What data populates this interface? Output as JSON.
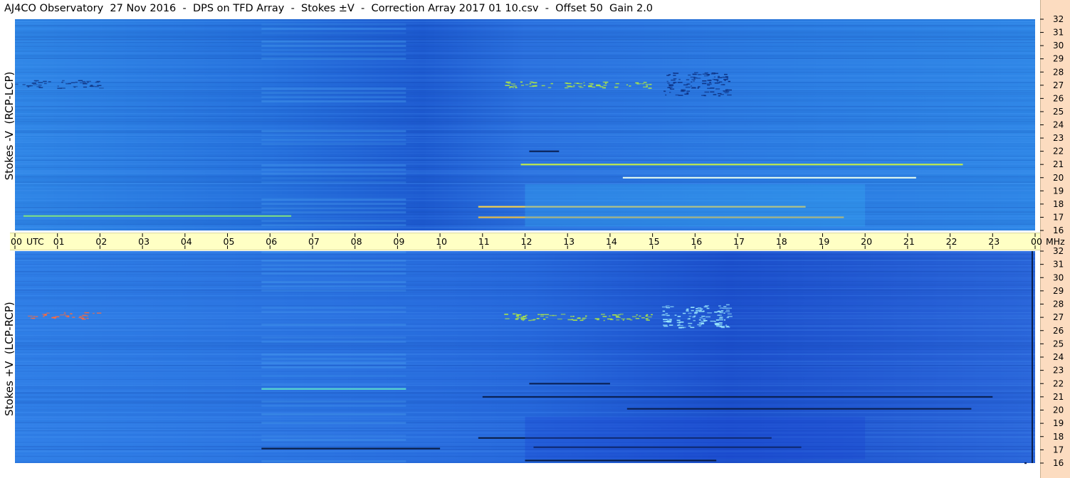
{
  "title": "AJ4CO Observatory  27 Nov 2016  -  DPS on TFD Array  -  Stokes ±V  -  Correction Array 2017 01 10.csv  -  Offset 50  Gain 2.0",
  "chart_data": [
    {
      "type": "heatmap",
      "panel": "top",
      "ylabel": "Stokes -V  (RCP-LCP)",
      "x_unit": "UTC",
      "x_ticks": [
        "00",
        "01",
        "02",
        "03",
        "04",
        "05",
        "06",
        "07",
        "08",
        "09",
        "10",
        "11",
        "12",
        "13",
        "14",
        "15",
        "16",
        "17",
        "18",
        "19",
        "20",
        "21",
        "22",
        "23",
        "00"
      ],
      "y_unit": "MHz",
      "y_ticks": [
        32,
        31,
        30,
        29,
        28,
        27,
        26,
        25,
        24,
        23,
        22,
        21,
        20,
        19,
        18,
        17,
        16
      ],
      "ylim": [
        16,
        32
      ],
      "xlim": [
        0,
        24
      ],
      "features": [
        {
          "kind": "speckle",
          "t": [
            0,
            2
          ],
          "f": [
            26.8,
            27.4
          ],
          "color": "#123a8a"
        },
        {
          "kind": "speckle",
          "t": [
            11.5,
            15
          ],
          "f": [
            26.8,
            27.3
          ],
          "color": "#b8f03a"
        },
        {
          "kind": "speckle",
          "t": [
            15.2,
            16.8
          ],
          "f": [
            26.2,
            28.0
          ],
          "color": "#0c2f80"
        },
        {
          "kind": "line",
          "t": [
            11.9,
            22.3
          ],
          "f": 21.0,
          "color": "#c8f040"
        },
        {
          "kind": "line",
          "t": [
            12.1,
            12.8
          ],
          "f": 22.0,
          "color": "#0a1f50"
        },
        {
          "kind": "line",
          "t": [
            14.3,
            21.2
          ],
          "f": 20.0,
          "color": "#e8fff0"
        },
        {
          "kind": "line",
          "t": [
            10.9,
            18.6
          ],
          "f": 17.8,
          "color": "#ffd84a"
        },
        {
          "kind": "line",
          "t": [
            10.9,
            19.5
          ],
          "f": 17.0,
          "color": "#f0c040"
        },
        {
          "kind": "line",
          "t": [
            0.2,
            6.5
          ],
          "f": 17.1,
          "color": "#7fe07f"
        },
        {
          "kind": "glow",
          "t": [
            12,
            20
          ],
          "f": [
            16.3,
            19.5
          ],
          "color": "#36a8f0"
        }
      ]
    },
    {
      "type": "heatmap",
      "panel": "bottom",
      "ylabel": "Stokes +V  (LCP-RCP)",
      "x_unit": "UTC",
      "x_ticks": [
        "00",
        "01",
        "02",
        "03",
        "04",
        "05",
        "06",
        "07",
        "08",
        "09",
        "10",
        "11",
        "12",
        "13",
        "14",
        "15",
        "16",
        "17",
        "18",
        "19",
        "20",
        "21",
        "22",
        "23",
        "00"
      ],
      "y_unit": "MHz",
      "y_ticks": [
        32,
        31,
        30,
        29,
        28,
        27,
        26,
        25,
        24,
        23,
        22,
        21,
        20,
        19,
        18,
        17,
        16
      ],
      "ylim": [
        16,
        32
      ],
      "xlim": [
        0,
        24
      ],
      "features": [
        {
          "kind": "speckle",
          "t": [
            0.2,
            2
          ],
          "f": [
            26.9,
            27.4
          ],
          "color": "#ff6a3a"
        },
        {
          "kind": "speckle",
          "t": [
            11.5,
            15
          ],
          "f": [
            26.8,
            27.3
          ],
          "color": "#b8f03a"
        },
        {
          "kind": "speckle",
          "t": [
            15.2,
            16.8
          ],
          "f": [
            26.2,
            28.0
          ],
          "color": "#a0f0ff"
        },
        {
          "kind": "line",
          "t": [
            5.8,
            9.2
          ],
          "f": 21.6,
          "color": "#5ad8d0"
        },
        {
          "kind": "line",
          "t": [
            11.0,
            23.0
          ],
          "f": 21.0,
          "color": "#0a1f50"
        },
        {
          "kind": "line",
          "t": [
            12.1,
            14.0
          ],
          "f": 22.0,
          "color": "#0a1f50"
        },
        {
          "kind": "line",
          "t": [
            14.4,
            22.5
          ],
          "f": 20.1,
          "color": "#0a1f50"
        },
        {
          "kind": "line",
          "t": [
            10.9,
            17.8
          ],
          "f": 17.9,
          "color": "#081a40"
        },
        {
          "kind": "line",
          "t": [
            5.8,
            10.0
          ],
          "f": 17.1,
          "color": "#081a40"
        },
        {
          "kind": "line",
          "t": [
            12.2,
            18.5
          ],
          "f": 17.2,
          "color": "#081a40"
        },
        {
          "kind": "line",
          "t": [
            12.0,
            16.5
          ],
          "f": 16.2,
          "color": "#081a40"
        },
        {
          "kind": "line",
          "t": [
            23.75,
            23.8
          ],
          "f": 16.0,
          "color": "#0a1f50"
        },
        {
          "kind": "glow",
          "t": [
            12,
            20
          ],
          "f": [
            16.3,
            19.5
          ],
          "color": "#1a46d0"
        }
      ]
    }
  ]
}
